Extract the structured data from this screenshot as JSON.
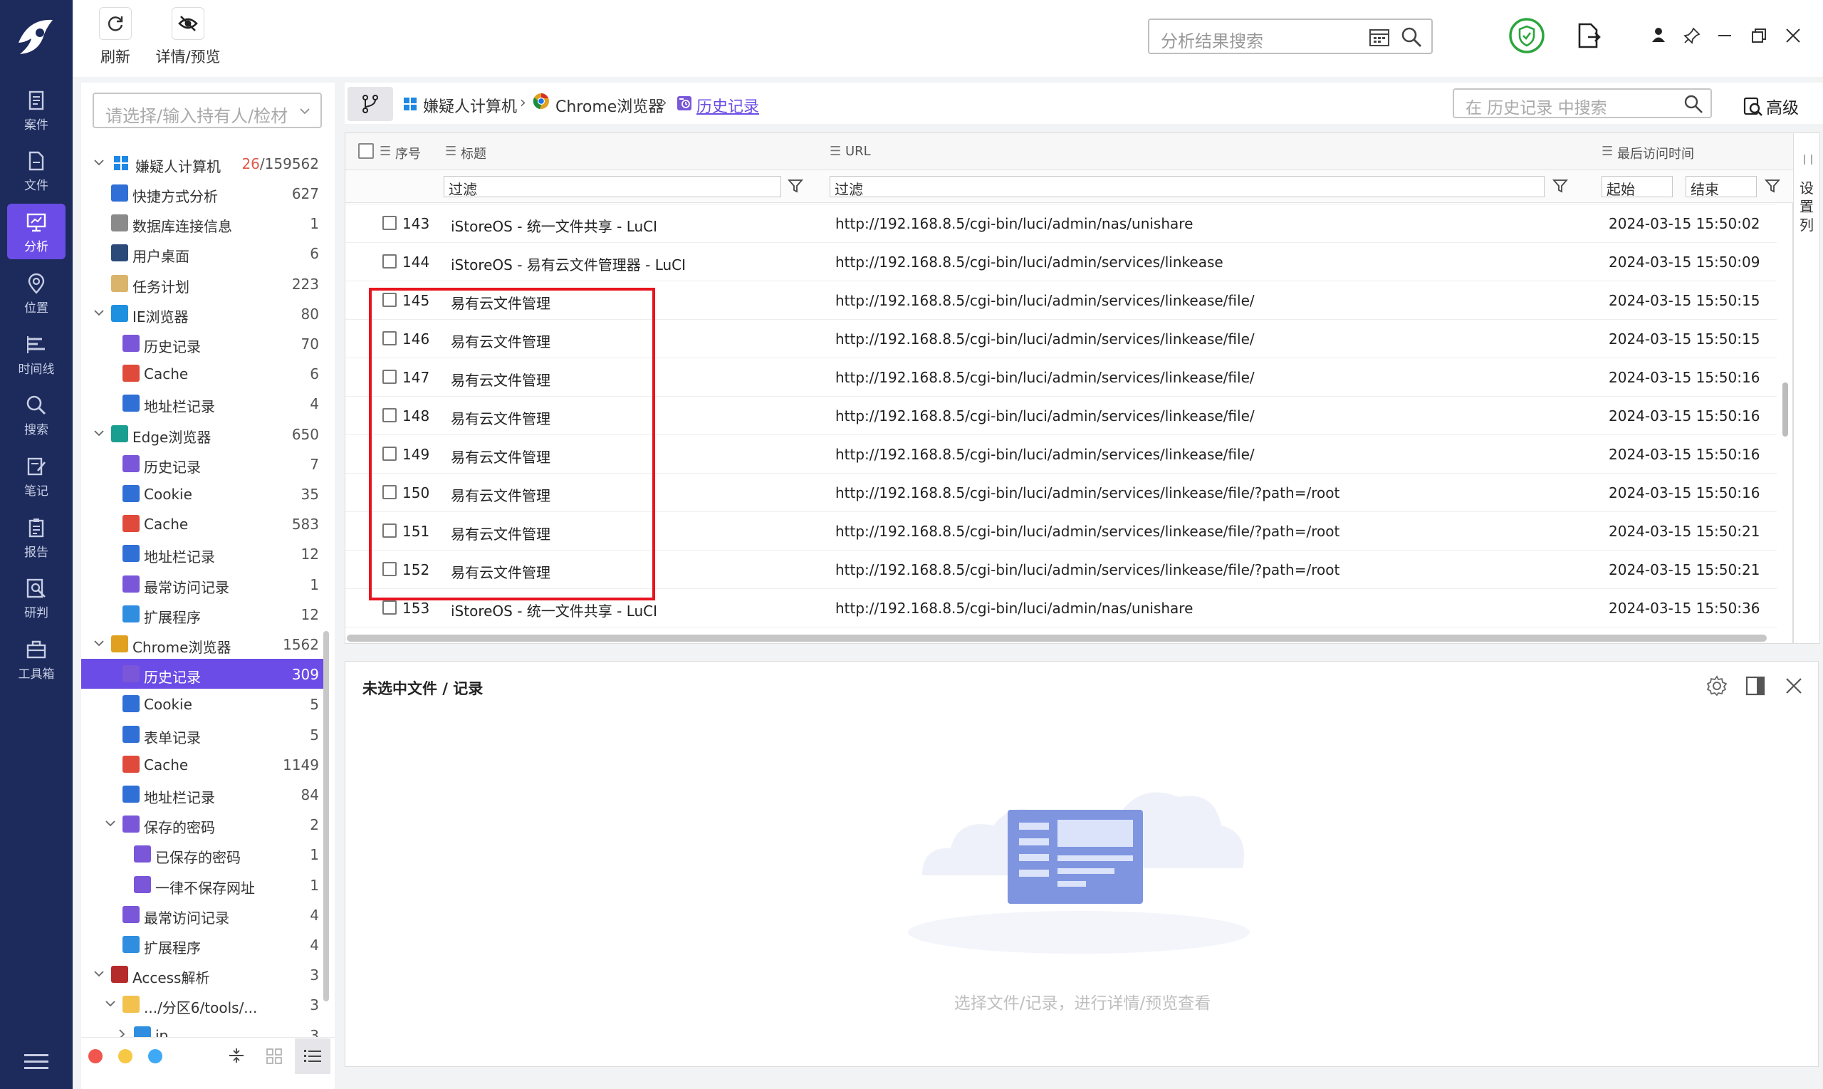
{
  "nav": {
    "items": [
      {
        "label": "案件",
        "icon": "case-icon"
      },
      {
        "label": "文件",
        "icon": "file-icon"
      },
      {
        "label": "分析",
        "icon": "analysis-icon",
        "active": true
      },
      {
        "label": "位置",
        "icon": "location-icon"
      },
      {
        "label": "时间线",
        "icon": "timeline-icon"
      },
      {
        "label": "搜索",
        "icon": "search-icon"
      },
      {
        "label": "笔记",
        "icon": "note-icon"
      },
      {
        "label": "报告",
        "icon": "report-icon"
      },
      {
        "label": "研判",
        "icon": "judge-icon"
      },
      {
        "label": "工具箱",
        "icon": "toolbox-icon"
      }
    ]
  },
  "toolbar": {
    "refresh_label": "刷新",
    "detail_label": "详情/预览",
    "search_placeholder": "分析结果搜索"
  },
  "tree": {
    "holder_placeholder": "请选择/输入持有人/检材",
    "root": {
      "label": "嫌疑人计算机",
      "count_red": "26",
      "count_total": "/159562"
    },
    "items": [
      {
        "label": "快捷方式分析",
        "count": "627",
        "level": 1,
        "icon": "shortcut-icon",
        "color": "#2f6fd6"
      },
      {
        "label": "数据库连接信息",
        "count": "1",
        "level": 1,
        "icon": "database-icon",
        "color": "#8a8a8a"
      },
      {
        "label": "用户桌面",
        "count": "6",
        "level": 1,
        "icon": "desktop-icon",
        "color": "#2b4a7a"
      },
      {
        "label": "任务计划",
        "count": "223",
        "level": 1,
        "icon": "task-icon",
        "color": "#d9b46a"
      },
      {
        "label": "IE浏览器",
        "count": "80",
        "level": 1,
        "icon": "ie-icon",
        "color": "#1e90e0",
        "expanded": true
      },
      {
        "label": "历史记录",
        "count": "70",
        "level": 2,
        "icon": "history-icon",
        "color": "#7a56d9"
      },
      {
        "label": "Cache",
        "count": "6",
        "level": 2,
        "icon": "cache-icon",
        "color": "#e04a3a"
      },
      {
        "label": "地址栏记录",
        "count": "4",
        "level": 2,
        "icon": "addressbar-icon",
        "color": "#2f6fd6"
      },
      {
        "label": "Edge浏览器",
        "count": "650",
        "level": 1,
        "icon": "edge-icon",
        "color": "#1a9e8f",
        "expanded": true
      },
      {
        "label": "历史记录",
        "count": "7",
        "level": 2,
        "icon": "history-icon",
        "color": "#7a56d9"
      },
      {
        "label": "Cookie",
        "count": "35",
        "level": 2,
        "icon": "cookie-icon",
        "color": "#2f6fd6"
      },
      {
        "label": "Cache",
        "count": "583",
        "level": 2,
        "icon": "cache-icon",
        "color": "#e04a3a"
      },
      {
        "label": "地址栏记录",
        "count": "12",
        "level": 2,
        "icon": "addressbar-icon",
        "color": "#2f6fd6"
      },
      {
        "label": "最常访问记录",
        "count": "1",
        "level": 2,
        "icon": "frequent-icon",
        "color": "#7a56d9"
      },
      {
        "label": "扩展程序",
        "count": "12",
        "level": 2,
        "icon": "extension-icon",
        "color": "#2f8ee0"
      },
      {
        "label": "Chrome浏览器",
        "count": "1562",
        "level": 1,
        "icon": "chrome-icon",
        "color": "#e0a020",
        "expanded": true
      },
      {
        "label": "历史记录",
        "count": "309",
        "level": 2,
        "icon": "history-icon",
        "color": "#7a56d9",
        "selected": true
      },
      {
        "label": "Cookie",
        "count": "5",
        "level": 2,
        "icon": "cookie-icon",
        "color": "#2f6fd6"
      },
      {
        "label": "表单记录",
        "count": "5",
        "level": 2,
        "icon": "form-icon",
        "color": "#2f6fd6"
      },
      {
        "label": "Cache",
        "count": "1149",
        "level": 2,
        "icon": "cache-icon",
        "color": "#e04a3a"
      },
      {
        "label": "地址栏记录",
        "count": "84",
        "level": 2,
        "icon": "addressbar-icon",
        "color": "#2f6fd6"
      },
      {
        "label": "保存的密码",
        "count": "2",
        "level": 2,
        "icon": "password-icon",
        "color": "#7a56d9",
        "expanded": true
      },
      {
        "label": "已保存的密码",
        "count": "1",
        "level": 3,
        "icon": "password-icon",
        "color": "#7a56d9"
      },
      {
        "label": "一律不保存网址",
        "count": "1",
        "level": 3,
        "icon": "password-icon",
        "color": "#7a56d9"
      },
      {
        "label": "最常访问记录",
        "count": "4",
        "level": 2,
        "icon": "frequent-icon",
        "color": "#7a56d9"
      },
      {
        "label": "扩展程序",
        "count": "4",
        "level": 2,
        "icon": "extension-icon",
        "color": "#2f8ee0"
      },
      {
        "label": "Access解析",
        "count": "3",
        "level": 1,
        "icon": "access-icon",
        "color": "#b52a2a",
        "expanded": true
      },
      {
        "label": ".../分区6/tools/...",
        "count": "3",
        "level": 2,
        "icon": "folder-icon",
        "color": "#f2c14e",
        "expanded": true
      },
      {
        "label": "ip",
        "count": "3",
        "level": 3,
        "icon": "db-icon",
        "color": "#2f8ee0",
        "collapsed": true
      }
    ]
  },
  "breadcrumb": {
    "computer": "嫌疑人计算机",
    "browser": "Chrome浏览器",
    "current": "历史记录",
    "search_placeholder": "在 历史记录 中搜索",
    "advanced": "高级"
  },
  "table": {
    "headers": {
      "seq": "序号",
      "title": "标题",
      "url": "URL",
      "time": "最后访问时间"
    },
    "filter": "过滤",
    "start": "起始",
    "end": "结束",
    "set_columns": "设置列",
    "rows": [
      {
        "no": "143",
        "title": "iStoreOS - 统一文件共享 - LuCI",
        "url": "http://192.168.8.5/cgi-bin/luci/admin/nas/unishare",
        "time": "2024-03-15 15:50:02"
      },
      {
        "no": "144",
        "title": "iStoreOS - 易有云文件管理器 - LuCI",
        "url": "http://192.168.8.5/cgi-bin/luci/admin/services/linkease",
        "time": "2024-03-15 15:50:09"
      },
      {
        "no": "145",
        "title": "易有云文件管理",
        "url": "http://192.168.8.5/cgi-bin/luci/admin/services/linkease/file/",
        "time": "2024-03-15 15:50:15"
      },
      {
        "no": "146",
        "title": "易有云文件管理",
        "url": "http://192.168.8.5/cgi-bin/luci/admin/services/linkease/file/",
        "time": "2024-03-15 15:50:15"
      },
      {
        "no": "147",
        "title": "易有云文件管理",
        "url": "http://192.168.8.5/cgi-bin/luci/admin/services/linkease/file/",
        "time": "2024-03-15 15:50:16"
      },
      {
        "no": "148",
        "title": "易有云文件管理",
        "url": "http://192.168.8.5/cgi-bin/luci/admin/services/linkease/file/",
        "time": "2024-03-15 15:50:16"
      },
      {
        "no": "149",
        "title": "易有云文件管理",
        "url": "http://192.168.8.5/cgi-bin/luci/admin/services/linkease/file/",
        "time": "2024-03-15 15:50:16"
      },
      {
        "no": "150",
        "title": "易有云文件管理",
        "url": "http://192.168.8.5/cgi-bin/luci/admin/services/linkease/file/?path=/root",
        "time": "2024-03-15 15:50:16"
      },
      {
        "no": "151",
        "title": "易有云文件管理",
        "url": "http://192.168.8.5/cgi-bin/luci/admin/services/linkease/file/?path=/root",
        "time": "2024-03-15 15:50:21"
      },
      {
        "no": "152",
        "title": "易有云文件管理",
        "url": "http://192.168.8.5/cgi-bin/luci/admin/services/linkease/file/?path=/root",
        "time": "2024-03-15 15:50:21"
      },
      {
        "no": "153",
        "title": "iStoreOS - 统一文件共享 - LuCI",
        "url": "http://192.168.8.5/cgi-bin/luci/admin/nas/unishare",
        "time": "2024-03-15 15:50:36"
      }
    ]
  },
  "preview": {
    "title": "未选中文件 / 记录",
    "hint": "选择文件/记录，进行详情/预览查看"
  },
  "colors": {
    "accent": "#6b4ce6",
    "nav_bg": "#1c2a5c",
    "highlight": "#e8141e",
    "count_red": "#e05a4a"
  }
}
